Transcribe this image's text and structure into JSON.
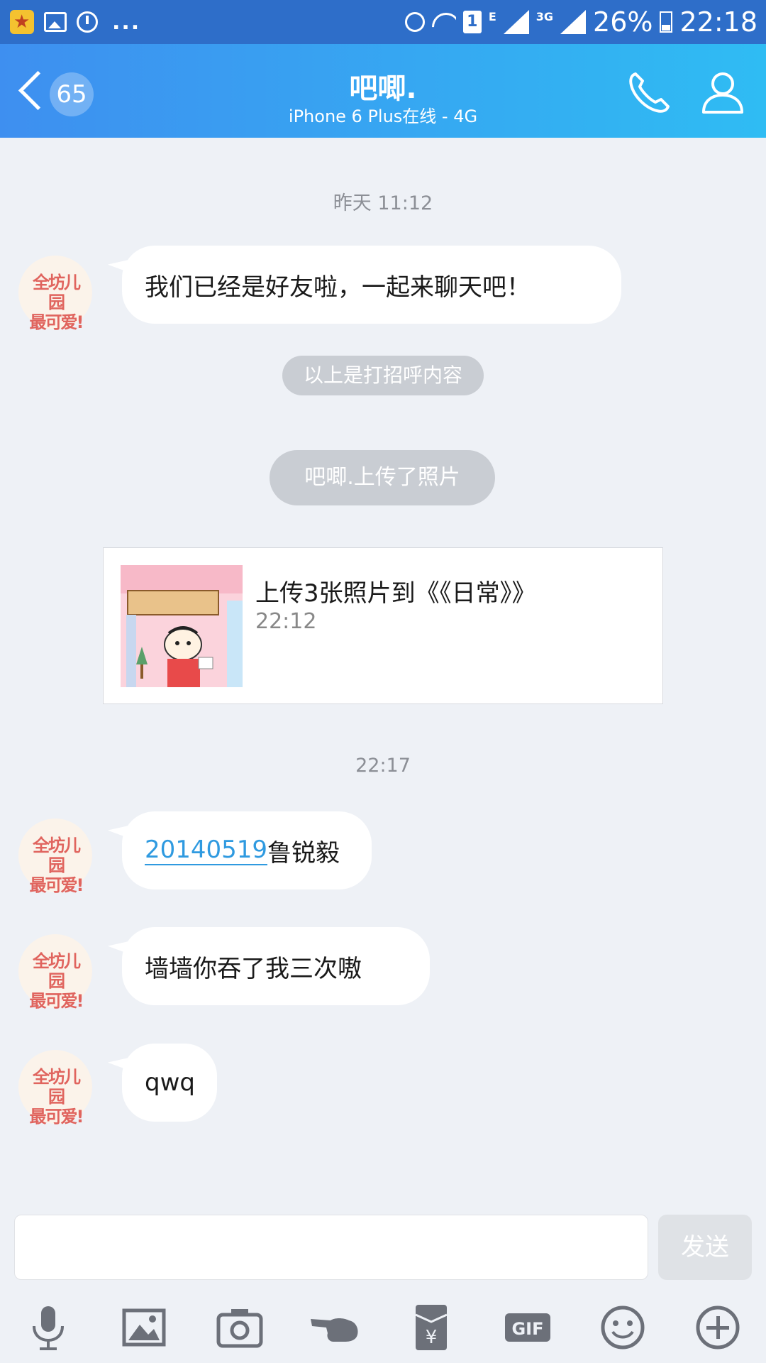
{
  "status_bar": {
    "battery": "26%",
    "time": "22:18",
    "sim": "1",
    "net_e": "E",
    "net_3g": "3G",
    "dots": "..."
  },
  "header": {
    "back_count": "65",
    "title": "吧唧.",
    "subtitle": "iPhone 6 Plus在线 - 4G"
  },
  "chat": {
    "time1": "昨天 11:12",
    "msg1": "我们已经是好友啦，一起来聊天吧！",
    "greeting_note": "以上是打招呼内容",
    "upload_note": "吧唧.上传了照片",
    "share": {
      "title": "上传3张照片到《《日常》》",
      "time": "22:12"
    },
    "time2": "22:17",
    "msg2_link": "20140519",
    "msg2_text": "鲁锐毅",
    "msg3": "墙墙你吞了我三次嗷",
    "msg4": "qwq",
    "avatar_text_1": "全坊儿园",
    "avatar_text_2": "最可爱!"
  },
  "input": {
    "placeholder": "",
    "send_label": "发送"
  },
  "toolbar": {
    "gif_label": "GIF"
  },
  "colors": {
    "header_start": "#3e8ff0",
    "header_end": "#2fbcf3",
    "background": "#eef1f6",
    "link": "#2f9ae0"
  }
}
